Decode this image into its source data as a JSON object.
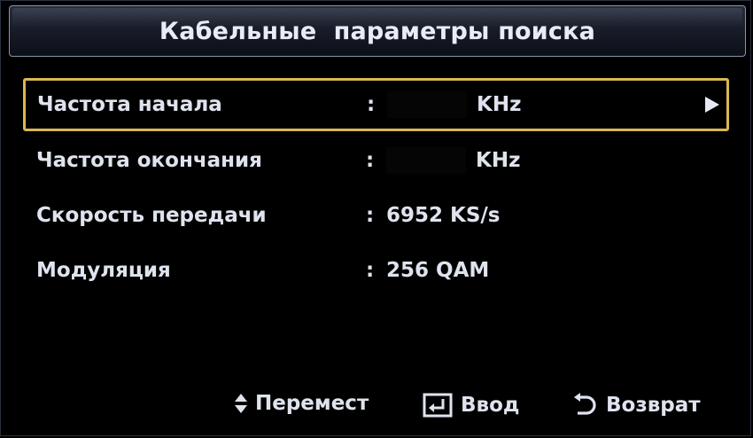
{
  "header": {
    "title": "Кабельные  параметры поиска"
  },
  "settings": {
    "rows": [
      {
        "label": "Частота начала",
        "separator": ":",
        "value": "",
        "unit": "KHz",
        "selected": true
      },
      {
        "label": "Частота окончания",
        "separator": ":",
        "value": "",
        "unit": "KHz",
        "selected": false
      },
      {
        "label": "Скорость передачи",
        "separator": ":",
        "value": "6952 KS/s",
        "unit": "",
        "selected": false
      },
      {
        "label": "Модуляция",
        "separator": ":",
        "value": "256 QAM",
        "unit": "",
        "selected": false
      }
    ]
  },
  "footer": {
    "move_label": "Перемест",
    "enter_label": "Ввод",
    "return_label": "Возврат"
  },
  "icons": {
    "selected_row": "arrow-right-icon",
    "move": "up-down-arrows-icon",
    "enter": "enter-icon",
    "return": "return-icon"
  },
  "colors": {
    "background": "#000000",
    "text": "#dfe3ee",
    "selection_border": "#d9b850",
    "title_border": "#8a93a8"
  }
}
